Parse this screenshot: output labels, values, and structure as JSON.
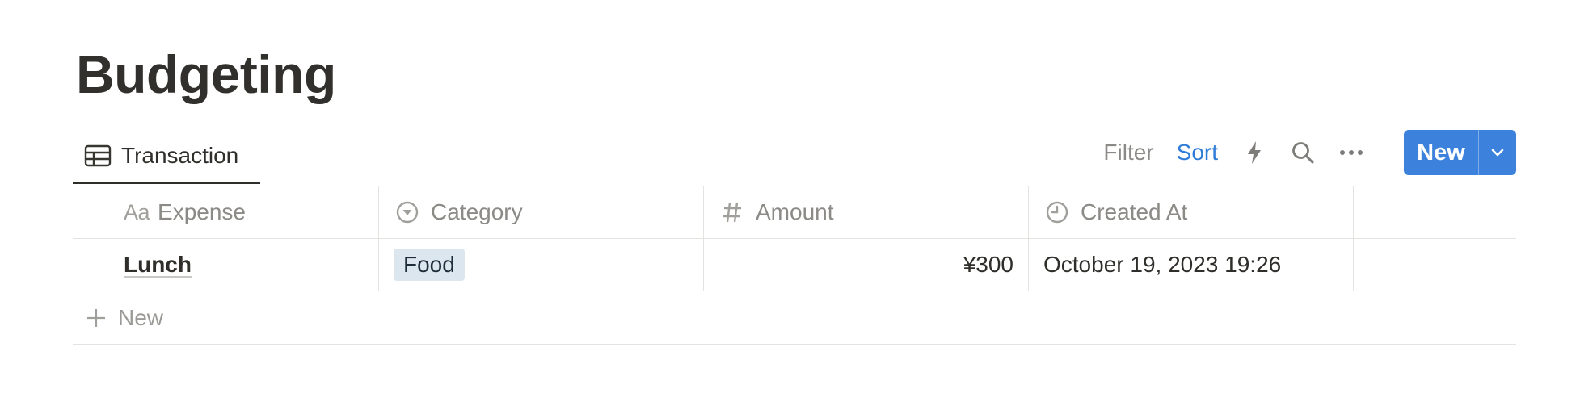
{
  "page": {
    "title": "Budgeting"
  },
  "view": {
    "tab_label": "Transaction",
    "tab_icon": "table-icon"
  },
  "toolbar": {
    "filter_label": "Filter",
    "sort_label": "Sort",
    "automation_icon": "lightning-icon",
    "search_icon": "search-icon",
    "more_icon": "more-icon",
    "new_label": "New",
    "new_dropdown_icon": "chevron-down-icon"
  },
  "table": {
    "columns": [
      {
        "label": "Expense",
        "icon": "Aa"
      },
      {
        "label": "Category",
        "icon": "select-icon"
      },
      {
        "label": "Amount",
        "icon": "#"
      },
      {
        "label": "Created At",
        "icon": "clock-icon"
      }
    ],
    "rows": [
      {
        "expense": "Lunch",
        "category": "Food",
        "amount": "¥300",
        "created_at": "October 19, 2023 19:26"
      }
    ],
    "add_label": "New"
  },
  "colors": {
    "accent": "#3c82dd",
    "sort_active": "#2f7bd8",
    "tag_bg": "#dbe6ef"
  }
}
